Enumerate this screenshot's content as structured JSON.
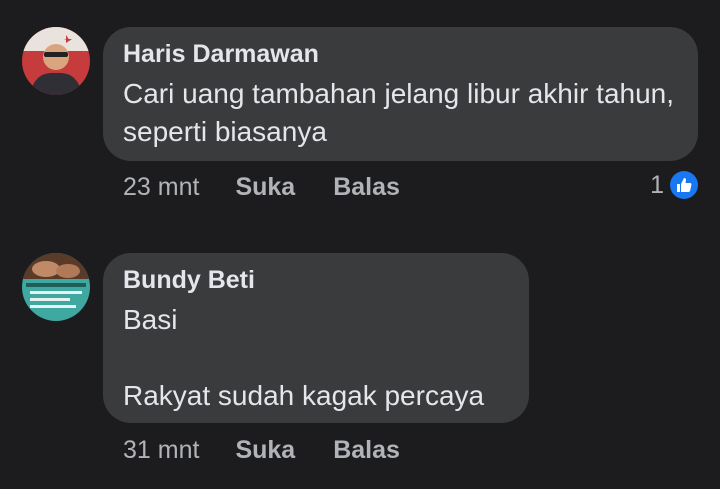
{
  "comments": [
    {
      "author": "Haris Darmawan",
      "text": "Cari uang tambahan jelang libur akhir tahun, seperti biasanya",
      "time": "23 mnt",
      "like_label": "Suka",
      "reply_label": "Balas",
      "reaction_count": "1",
      "reaction_icon": "like-icon",
      "reaction_color": "#1877f2"
    },
    {
      "author": "Bundy Beti",
      "text": "Basi\n\nRakyat sudah kagak percaya",
      "time": "31 mnt",
      "like_label": "Suka",
      "reply_label": "Balas"
    }
  ],
  "colors": {
    "background": "#1c1c1e",
    "bubble": "#3a3b3c",
    "text": "#e4e6eb",
    "secondary_text": "#b0b3b8",
    "accent": "#1877f2"
  }
}
